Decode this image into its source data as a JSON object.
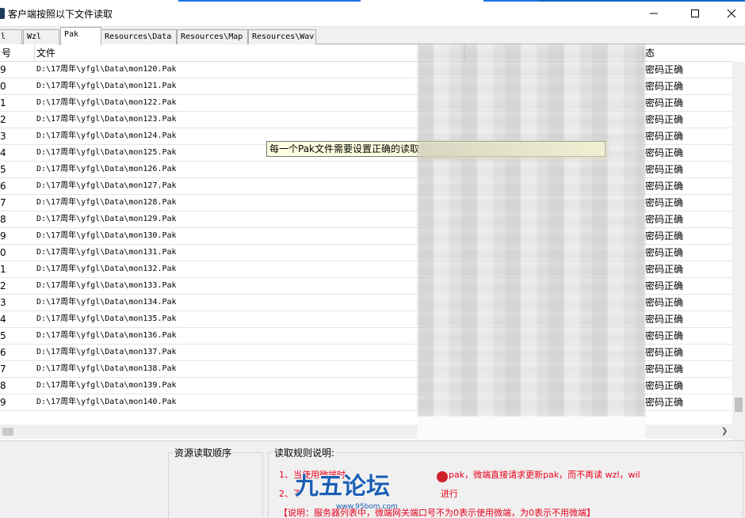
{
  "window": {
    "title": "客户端按照以下文件读取",
    "minimize": "minimize-icon",
    "maximize": "maximize-icon",
    "close": "close-icon"
  },
  "tabs": [
    {
      "label": "l",
      "active": false
    },
    {
      "label": "Wzl",
      "active": false
    },
    {
      "label": "Pak",
      "active": true
    },
    {
      "label": "Resources\\Data",
      "active": false
    },
    {
      "label": "Resources\\Map",
      "active": false
    },
    {
      "label": "Resources\\Wav",
      "active": false
    }
  ],
  "table": {
    "headers": {
      "index": "号",
      "file": "文件",
      "status": "态"
    },
    "rows": [
      {
        "index": "9",
        "file": "D:\\17周年\\yfgl\\Data\\mon120.Pak",
        "status": "密码正确"
      },
      {
        "index": "0",
        "file": "D:\\17周年\\yfgl\\Data\\mon121.Pak",
        "status": "密码正确"
      },
      {
        "index": "1",
        "file": "D:\\17周年\\yfgl\\Data\\mon122.Pak",
        "status": "密码正确"
      },
      {
        "index": "2",
        "file": "D:\\17周年\\yfgl\\Data\\mon123.Pak",
        "status": "密码正确"
      },
      {
        "index": "3",
        "file": "D:\\17周年\\yfgl\\Data\\mon124.Pak",
        "status": "密码正确"
      },
      {
        "index": "4",
        "file": "D:\\17周年\\yfgl\\Data\\mon125.Pak",
        "status": "密码正确"
      },
      {
        "index": "5",
        "file": "D:\\17周年\\yfgl\\Data\\mon126.Pak",
        "status": "密码正确"
      },
      {
        "index": "6",
        "file": "D:\\17周年\\yfgl\\Data\\mon127.Pak",
        "status": "密码正确"
      },
      {
        "index": "7",
        "file": "D:\\17周年\\yfgl\\Data\\mon128.Pak",
        "status": "密码正确"
      },
      {
        "index": "8",
        "file": "D:\\17周年\\yfgl\\Data\\mon129.Pak",
        "status": "密码正确"
      },
      {
        "index": "9",
        "file": "D:\\17周年\\yfgl\\Data\\mon130.Pak",
        "status": "密码正确"
      },
      {
        "index": "0",
        "file": "D:\\17周年\\yfgl\\Data\\mon131.Pak",
        "status": "密码正确"
      },
      {
        "index": "1",
        "file": "D:\\17周年\\yfgl\\Data\\mon132.Pak",
        "status": "密码正确"
      },
      {
        "index": "2",
        "file": "D:\\17周年\\yfgl\\Data\\mon133.Pak",
        "status": "密码正确"
      },
      {
        "index": "3",
        "file": "D:\\17周年\\yfgl\\Data\\mon134.Pak",
        "status": "密码正确"
      },
      {
        "index": "4",
        "file": "D:\\17周年\\yfgl\\Data\\mon135.Pak",
        "status": "密码正确"
      },
      {
        "index": "5",
        "file": "D:\\17周年\\yfgl\\Data\\mon136.Pak",
        "status": "密码正确"
      },
      {
        "index": "6",
        "file": "D:\\17周年\\yfgl\\Data\\mon137.Pak",
        "status": "密码正确"
      },
      {
        "index": "7",
        "file": "D:\\17周年\\yfgl\\Data\\mon138.Pak",
        "status": "密码正确"
      },
      {
        "index": "8",
        "file": "D:\\17周年\\yfgl\\Data\\mon139.Pak",
        "status": "密码正确"
      },
      {
        "index": "9",
        "file": "D:\\17周年\\yfgl\\Data\\mon140.Pak",
        "status": "密码正确"
      }
    ]
  },
  "tooltip": {
    "text": "每一个Pak文件需要设置正确的读取"
  },
  "bottom": {
    "order_title": "资源读取顺序",
    "rules_title": "读取规则说明:",
    "rule1_a": "1、当使用微端时",
    "rule1_b": "pak，微端直接请求更新pak，而不再读 wzl，wil",
    "rule2_a": "2、不",
    "rule2_b": "进行",
    "note": "【说明：服务器列表中，微端网关端口号不为0表示使用微端，为0表示不用微端】",
    "rule_color": "#e8001c"
  },
  "watermark": {
    "text": "九五论坛",
    "url": "www.95bom.com"
  }
}
